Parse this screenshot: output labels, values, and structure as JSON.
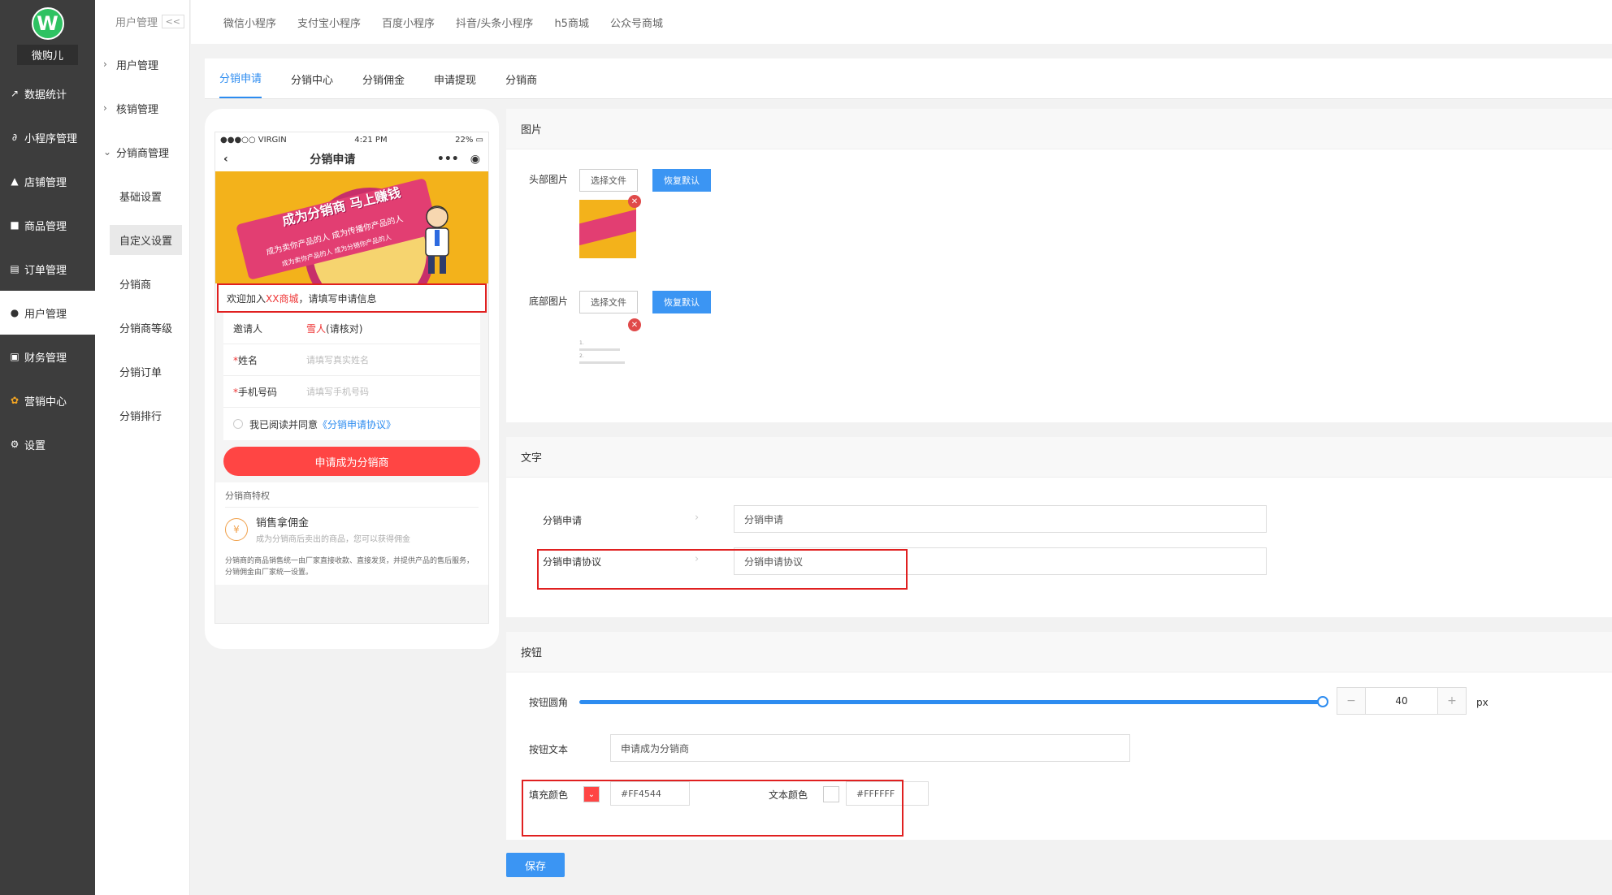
{
  "brand": {
    "name": "微购儿",
    "logo_letter": "W"
  },
  "sidebar": {
    "items": [
      {
        "label": "数据统计",
        "icon": "chart-icon"
      },
      {
        "label": "小程序管理",
        "icon": "link-icon"
      },
      {
        "label": "店铺管理",
        "icon": "store-icon"
      },
      {
        "label": "商品管理",
        "icon": "box-icon"
      },
      {
        "label": "订单管理",
        "icon": "order-icon"
      },
      {
        "label": "用户管理",
        "icon": "user-icon"
      },
      {
        "label": "财务管理",
        "icon": "wallet-icon"
      },
      {
        "label": "营销中心",
        "icon": "marketing-icon"
      },
      {
        "label": "设置",
        "icon": "gear-icon"
      }
    ]
  },
  "submenu": {
    "title": "用户管理",
    "collapse": "<<",
    "groups": [
      "用户管理",
      "核销管理",
      "分销商管理"
    ],
    "children": [
      "基础设置",
      "自定义设置",
      "分销商",
      "分销商等级",
      "分销订单",
      "分销排行"
    ]
  },
  "toptabs": [
    "微信小程序",
    "支付宝小程序",
    "百度小程序",
    "抖音/头条小程序",
    "h5商城",
    "公众号商城"
  ],
  "subtabs": [
    "分销申请",
    "分销中心",
    "分销佣金",
    "申请提现",
    "分销商"
  ],
  "phone": {
    "carrier": "●●●○○ VIRGIN",
    "time": "4:21 PM",
    "battery": "22%",
    "title": "分销申请",
    "banner_headline": "成为分销商 马上赚钱",
    "banner_sub1": "成为卖你产品的人 成为传播你产品的人",
    "banner_sub2": "成为卖你产品的人 成为分销你产品的人",
    "welcome_pre": "欢迎加入",
    "welcome_shop": "XX商城",
    "welcome_post": "，请填写申请信息",
    "inviter_label": "邀请人",
    "inviter_name": "雪人",
    "inviter_note": "(请核对)",
    "name_label": "姓名",
    "name_ph": "请填写真实姓名",
    "phone_label": "手机号码",
    "phone_ph": "请填写手机号码",
    "agree_text": "我已阅读并同意",
    "agree_link": "《分销申请协议》",
    "apply_btn": "申请成为分销商",
    "priv_title": "分销商特权",
    "priv_name": "销售拿佣金",
    "priv_desc": "成为分销商后卖出的商品，您可以获得佣金",
    "priv_note": "分销商的商品销售统一由厂家直接收款、直接发货，并提供产品的售后服务，分销佣金由厂家统一设置。"
  },
  "images_panel": {
    "title": "图片",
    "head_label": "头部图片",
    "foot_label": "底部图片",
    "choose": "选择文件",
    "restore": "恢复默认",
    "foot_thumb_line1": "1.",
    "foot_thumb_line2": "2.",
    "close_glyph": "✕"
  },
  "text_panel": {
    "title": "文字",
    "row1_label": "分销申请",
    "row1_value": "分销申请",
    "row2_label": "分销申请协议",
    "row2_value": "分销申请协议"
  },
  "button_panel": {
    "title": "按钮",
    "radius_label": "按钮圆角",
    "radius_value": "40",
    "radius_unit": "px",
    "radius_fraction": 1.0,
    "text_label": "按钮文本",
    "text_value": "申请成为分销商",
    "fill_label": "填充颜色",
    "fill_value": "#FF4544",
    "textcolor_label": "文本颜色",
    "textcolor_value": "#FFFFFF"
  },
  "save_label": "保存",
  "colors": {
    "accent": "#3b95f3",
    "danger": "#ff4544",
    "sidebar": "#3d3d3d"
  }
}
